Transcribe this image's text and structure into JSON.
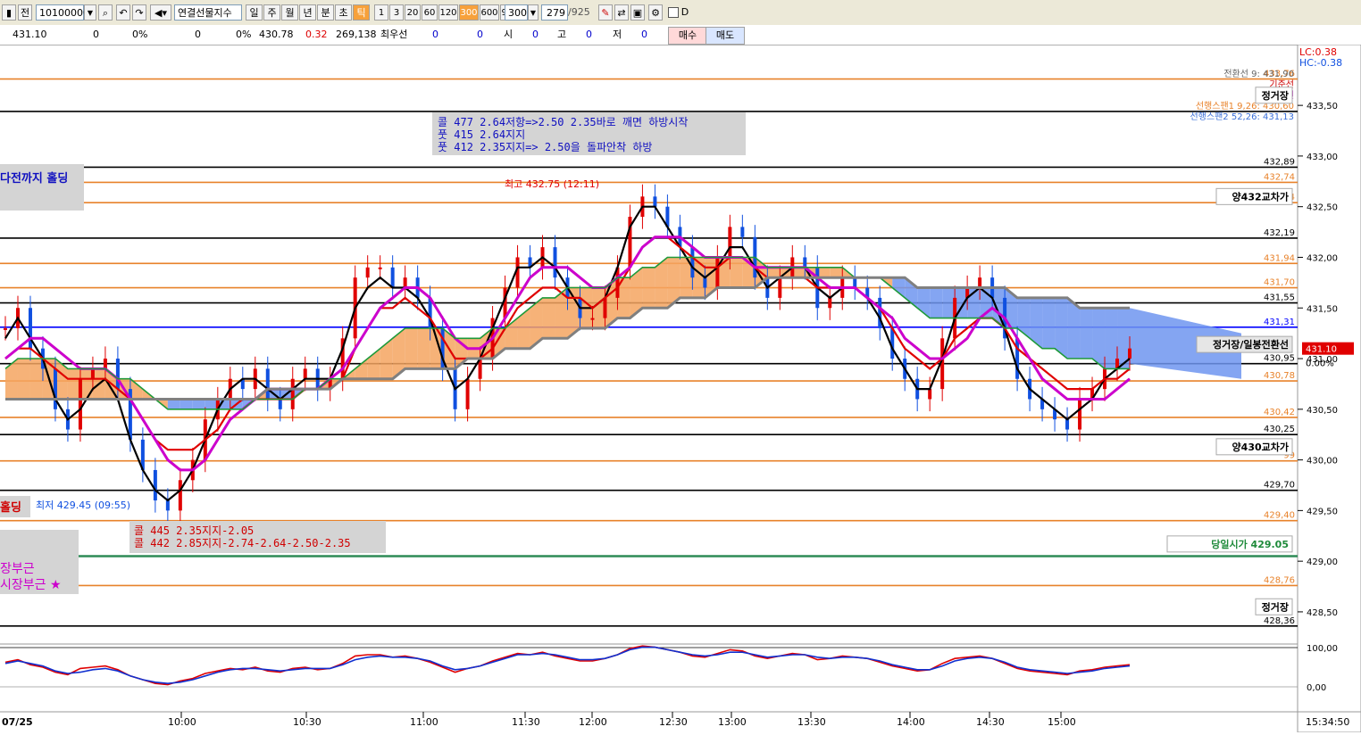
{
  "toolbar": {
    "code": "10100000",
    "name": "연결선물지수",
    "period_buttons": [
      "일",
      "주",
      "월",
      "년",
      "분",
      "초",
      "틱"
    ],
    "active_period": "틱",
    "interval_buttons": [
      "1",
      "3",
      "20",
      "60",
      "120",
      "300",
      "600",
      "900"
    ],
    "active_interval": "300",
    "count_value": "300",
    "page_current": "279",
    "page_total": "/925",
    "checkbox_label": "D",
    "chart_left_label": "전"
  },
  "quote": {
    "price": "431.10",
    "vol1": "0",
    "pct1": "0%",
    "vol2": "0",
    "pct2": "0%",
    "prev": "430.78",
    "change": "0.32",
    "volume": "269,138",
    "best_label": "최우선",
    "best1": "0",
    "best2": "0",
    "open_label": "시",
    "open_val": "0",
    "high_label": "고",
    "high_val": "0",
    "low_label": "저",
    "low_val": "0",
    "buy_label": "매수",
    "sell_label": "매도"
  },
  "chart_data": {
    "type": "candlestick",
    "date_label": "07/25",
    "x_ticks": [
      "10:00",
      "10:30",
      "11:00",
      "11:30",
      "12:00",
      "12:30",
      "13:00",
      "13:30",
      "14:00",
      "14:30",
      "15:00"
    ],
    "time_readout": "15:34:50",
    "y_ticks": [
      433.5,
      433.0,
      432.5,
      432.0,
      431.5,
      431.0,
      430.5,
      430.0,
      429.5,
      429.0,
      428.5
    ],
    "y_tick_labels": [
      "433,50",
      "433,00",
      "432,50",
      "432,00",
      "431,50",
      "431,00",
      "430,50",
      "430,00",
      "429,50",
      "429,00",
      "428,50"
    ],
    "ylim": [
      428.2,
      434.1
    ],
    "current_price": "431.10",
    "current_pct": "0.00%",
    "lc_label": "LC:0.38",
    "hc_label": "HC:-0.38",
    "high_annotation": "최고 432.75 (12:11)",
    "low_annotation": "최저 429.45 (09:55)",
    "horizontal_levels": [
      {
        "value": 433.76,
        "label": "433,76",
        "color": "#e8822a"
      },
      {
        "value": 433.44,
        "label": "",
        "color": "#000000"
      },
      {
        "value": 432.89,
        "label": "432,89",
        "color": "#000000"
      },
      {
        "value": 432.74,
        "label": "432,74",
        "color": "#e8822a"
      },
      {
        "value": 432.54,
        "label": "432,54",
        "color": "#e8822a"
      },
      {
        "value": 432.19,
        "label": "432,19",
        "color": "#000000"
      },
      {
        "value": 431.94,
        "label": "431,94",
        "color": "#e8822a"
      },
      {
        "value": 431.7,
        "label": "431,70",
        "color": "#e8822a"
      },
      {
        "value": 431.55,
        "label": "431,55",
        "color": "#000000"
      },
      {
        "value": 431.31,
        "label": "431,31",
        "color": "#0000ff"
      },
      {
        "value": 430.95,
        "label": "430,95",
        "color": "#000000"
      },
      {
        "value": 430.78,
        "label": "430,78",
        "color": "#e8822a"
      },
      {
        "value": 430.42,
        "label": "430,42",
        "color": "#e8822a"
      },
      {
        "value": 430.25,
        "label": "430,25",
        "color": "#000000"
      },
      {
        "value": 429.99,
        "label": "99",
        "color": "#e8822a"
      },
      {
        "value": 429.7,
        "label": "429,70",
        "color": "#000000"
      },
      {
        "value": 429.4,
        "label": "429,40",
        "color": "#e8822a"
      },
      {
        "value": 429.05,
        "label": "",
        "color": "#2e8b57"
      },
      {
        "value": 428.76,
        "label": "428,76",
        "color": "#e8822a"
      },
      {
        "value": 428.36,
        "label": "428,36",
        "color": "#000000"
      }
    ],
    "right_tags": [
      {
        "text": "정거장",
        "value": 433.6
      },
      {
        "text": "양432교차가",
        "value": 432.6
      },
      {
        "text": "정거장/일봉전환선",
        "value": 431.14
      },
      {
        "text": "양430교차가",
        "value": 430.13
      },
      {
        "text": "당일시가  429.05",
        "value": 429.17
      },
      {
        "text": "정거장",
        "value": 428.55
      }
    ],
    "indicator_labels": [
      {
        "text": "전환선 9: 431,90",
        "color": "#666666"
      },
      {
        "text": "기준선",
        "color": "#cc0000"
      },
      {
        "text": "후행스팬",
        "color": "#b000b0"
      },
      {
        "text": "선행스팬1 9,26: 430,60",
        "color": "#e8822a"
      },
      {
        "text": "선행스팬2 52,26: 431,13",
        "color": "#3a6fd8"
      }
    ],
    "notes_top": [
      "콜 477 2.64저항=>2.50 2.35바로 깨면 하방시작",
      "풋 415 2.64지지",
      "풋 412 2.35지지=> 2.50을 돌파안착 하방"
    ],
    "notes_bottom": [
      "콜 445 2.35지지-2.05",
      "콜 442 2.85지지-2.74-2.64-2.50-2.35"
    ],
    "left_note_blue": "다전까지 홀딩",
    "left_note_red": "홀딩",
    "left_note_magenta1": "장부근",
    "left_note_magenta2": "시장부근 ★",
    "osc_labels": [
      "100,00",
      "0,00"
    ],
    "series": [
      {
        "name": "close",
        "values": [
          431.3,
          431.5,
          431.1,
          430.9,
          430.5,
          430.3,
          430.8,
          430.9,
          431.0,
          430.7,
          430.2,
          429.9,
          429.6,
          429.5,
          429.8,
          430.0,
          430.4,
          430.6,
          430.8,
          430.7,
          430.9,
          430.6,
          430.5,
          430.8,
          430.9,
          430.7,
          430.8,
          431.2,
          431.8,
          431.9,
          431.9,
          431.7,
          431.8,
          431.6,
          431.3,
          430.9,
          430.5,
          430.8,
          431.0,
          431.4,
          431.7,
          432.0,
          431.9,
          432.1,
          431.8,
          431.6,
          431.4,
          431.4,
          431.6,
          431.9,
          432.4,
          432.6,
          432.5,
          432.3,
          432.1,
          431.8,
          431.7,
          432.0,
          432.3,
          432.2,
          431.8,
          431.6,
          431.8,
          432.0,
          431.9,
          431.5,
          431.6,
          431.8,
          431.7,
          431.6,
          431.3,
          431.0,
          430.8,
          430.6,
          430.7,
          431.2,
          431.6,
          431.7,
          431.8,
          431.6,
          431.2,
          430.8,
          430.6,
          430.5,
          430.4,
          430.3,
          430.6,
          430.7,
          430.9,
          431.0,
          431.1
        ]
      },
      {
        "name": "ma_black",
        "values": [
          431.2,
          431.4,
          431.2,
          431.0,
          430.6,
          430.4,
          430.5,
          430.7,
          430.8,
          430.6,
          430.2,
          429.9,
          429.7,
          429.6,
          429.7,
          429.9,
          430.2,
          430.5,
          430.7,
          430.8,
          430.8,
          430.7,
          430.6,
          430.7,
          430.8,
          430.8,
          430.8,
          431.1,
          431.5,
          431.7,
          431.8,
          431.7,
          431.7,
          431.6,
          431.4,
          431.0,
          430.7,
          430.8,
          431.0,
          431.3,
          431.6,
          431.9,
          431.9,
          432.0,
          431.9,
          431.7,
          431.5,
          431.5,
          431.6,
          431.9,
          432.3,
          432.5,
          432.5,
          432.3,
          432.1,
          431.9,
          431.8,
          431.9,
          432.1,
          432.1,
          431.9,
          431.7,
          431.8,
          431.9,
          431.9,
          431.7,
          431.6,
          431.7,
          431.7,
          431.6,
          431.4,
          431.1,
          430.9,
          430.7,
          430.7,
          431.0,
          431.4,
          431.6,
          431.7,
          431.6,
          431.3,
          430.9,
          430.7,
          430.6,
          430.5,
          430.4,
          430.5,
          430.6,
          430.8,
          430.9,
          431.0
        ]
      },
      {
        "name": "ma_red",
        "values": [
          431.0,
          431.1,
          431.1,
          431.0,
          430.9,
          430.8,
          430.8,
          430.8,
          430.8,
          430.7,
          430.6,
          430.4,
          430.2,
          430.1,
          430.1,
          430.1,
          430.2,
          430.3,
          430.5,
          430.6,
          430.6,
          430.6,
          430.6,
          430.6,
          430.7,
          430.7,
          430.7,
          430.8,
          431.1,
          431.3,
          431.5,
          431.5,
          431.6,
          431.5,
          431.4,
          431.2,
          431.0,
          431.0,
          431.0,
          431.1,
          431.3,
          431.5,
          431.6,
          431.7,
          431.7,
          431.6,
          431.6,
          431.5,
          431.6,
          431.7,
          431.9,
          432.1,
          432.2,
          432.2,
          432.1,
          432.0,
          431.9,
          431.9,
          432.0,
          432.0,
          431.9,
          431.8,
          431.8,
          431.8,
          431.8,
          431.7,
          431.7,
          431.7,
          431.7,
          431.6,
          431.5,
          431.3,
          431.1,
          431.0,
          430.9,
          431.0,
          431.2,
          431.3,
          431.4,
          431.4,
          431.3,
          431.1,
          431.0,
          430.9,
          430.8,
          430.7,
          430.7,
          430.7,
          430.8,
          430.8,
          430.9
        ]
      },
      {
        "name": "ma_magenta",
        "values": [
          431.0,
          431.1,
          431.2,
          431.2,
          431.1,
          431.0,
          430.9,
          430.9,
          430.9,
          430.8,
          430.6,
          430.4,
          430.2,
          430.0,
          429.9,
          429.9,
          430.0,
          430.2,
          430.4,
          430.5,
          430.6,
          430.7,
          430.7,
          430.7,
          430.7,
          430.7,
          430.8,
          430.9,
          431.1,
          431.3,
          431.5,
          431.6,
          431.7,
          431.7,
          431.6,
          431.4,
          431.2,
          431.1,
          431.1,
          431.2,
          431.4,
          431.6,
          431.8,
          431.9,
          431.9,
          431.9,
          431.8,
          431.7,
          431.7,
          431.8,
          431.9,
          432.1,
          432.2,
          432.2,
          432.2,
          432.1,
          432.0,
          432.0,
          432.0,
          432.0,
          431.9,
          431.9,
          431.9,
          431.9,
          431.9,
          431.8,
          431.7,
          431.7,
          431.7,
          431.6,
          431.5,
          431.4,
          431.2,
          431.1,
          431.0,
          431.0,
          431.1,
          431.2,
          431.4,
          431.5,
          431.4,
          431.2,
          431.0,
          430.8,
          430.7,
          430.6,
          430.6,
          430.6,
          430.6,
          430.7,
          430.8
        ]
      },
      {
        "name": "ma_green",
        "values": [
          430.9,
          431.0,
          431.0,
          431.0,
          431.0,
          430.9,
          430.9,
          430.9,
          430.9,
          430.8,
          430.8,
          430.7,
          430.6,
          430.5,
          430.5,
          430.5,
          430.5,
          430.5,
          430.5,
          430.5,
          430.6,
          430.6,
          430.6,
          430.6,
          430.7,
          430.7,
          430.8,
          430.8,
          430.9,
          431.0,
          431.1,
          431.2,
          431.3,
          431.3,
          431.3,
          431.3,
          431.2,
          431.2,
          431.2,
          431.3,
          431.3,
          431.4,
          431.5,
          431.6,
          431.6,
          431.7,
          431.7,
          431.7,
          431.7,
          431.8,
          431.8,
          431.9,
          431.9,
          432.0,
          432.0,
          432.0,
          432.0,
          432.0,
          432.0,
          432.0,
          432.0,
          431.9,
          431.9,
          431.9,
          431.9,
          431.9,
          431.9,
          431.9,
          431.8,
          431.8,
          431.8,
          431.7,
          431.6,
          431.5,
          431.4,
          431.4,
          431.4,
          431.4,
          431.4,
          431.4,
          431.3,
          431.3,
          431.2,
          431.1,
          431.1,
          431.0,
          431.0,
          431.0,
          430.9,
          430.9,
          430.9
        ]
      },
      {
        "name": "ma_gray",
        "values": [
          430.6,
          430.6,
          430.6,
          430.6,
          430.6,
          430.6,
          430.6,
          430.6,
          430.6,
          430.6,
          430.6,
          430.6,
          430.6,
          430.6,
          430.6,
          430.6,
          430.6,
          430.6,
          430.6,
          430.6,
          430.6,
          430.7,
          430.7,
          430.7,
          430.7,
          430.7,
          430.7,
          430.8,
          430.8,
          430.8,
          430.8,
          430.8,
          430.9,
          430.9,
          430.9,
          430.9,
          430.9,
          431.0,
          431.0,
          431.0,
          431.1,
          431.1,
          431.1,
          431.2,
          431.2,
          431.2,
          431.3,
          431.3,
          431.3,
          431.4,
          431.4,
          431.5,
          431.5,
          431.5,
          431.6,
          431.6,
          431.6,
          431.7,
          431.7,
          431.7,
          431.7,
          431.8,
          431.8,
          431.8,
          431.8,
          431.8,
          431.8,
          431.8,
          431.8,
          431.8,
          431.8,
          431.8,
          431.8,
          431.7,
          431.7,
          431.7,
          431.7,
          431.7,
          431.7,
          431.7,
          431.7,
          431.6,
          431.6,
          431.6,
          431.6,
          431.6,
          431.5,
          431.5,
          431.5,
          431.5,
          431.5
        ]
      }
    ]
  }
}
